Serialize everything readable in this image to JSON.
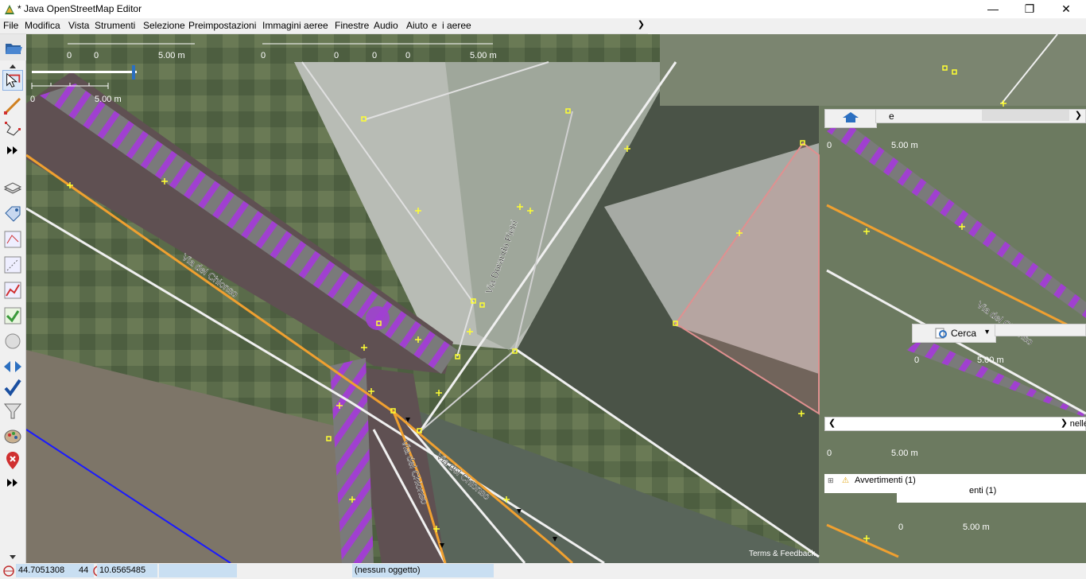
{
  "window": {
    "title": "* Java OpenStreetMap Editor",
    "minimize": "—",
    "maximize": "❐",
    "close": "✕"
  },
  "menu": {
    "items": [
      "File",
      "Modifica",
      "Vista",
      "Strumenti",
      "Selezione",
      "Preimpostazioni",
      "Immagini aeree",
      "Finestre",
      "Audio",
      "Aiuto",
      "e",
      "i aeree"
    ]
  },
  "map": {
    "streets": {
      "main_upper": "Via del Chionso",
      "main_lower": "Via del Chionso",
      "branch": "Via del Chionso",
      "cross": "Via Dorando Pietri"
    },
    "scale": {
      "zero": "0",
      "label": "5.00 m"
    },
    "attribution": "Terms & Feedback"
  },
  "side_panels": {
    "fragment_e": "e",
    "search_label": "Cerca",
    "warnings": "Avvertimenti (1)",
    "warnings_partial": "enti (1)",
    "fragment_nelle": "nelle"
  },
  "status": {
    "lat": "44.7051308",
    "lat_partial": "44",
    "lon": "10.6565485",
    "selection": "(nessun oggetto)"
  },
  "colors": {
    "road_orange": "#f0a030",
    "crossing_purple": "#a040d0",
    "boundary_blue": "#1a1aff",
    "building_pink": "#e09090",
    "node_yellow": "#ffff33"
  }
}
